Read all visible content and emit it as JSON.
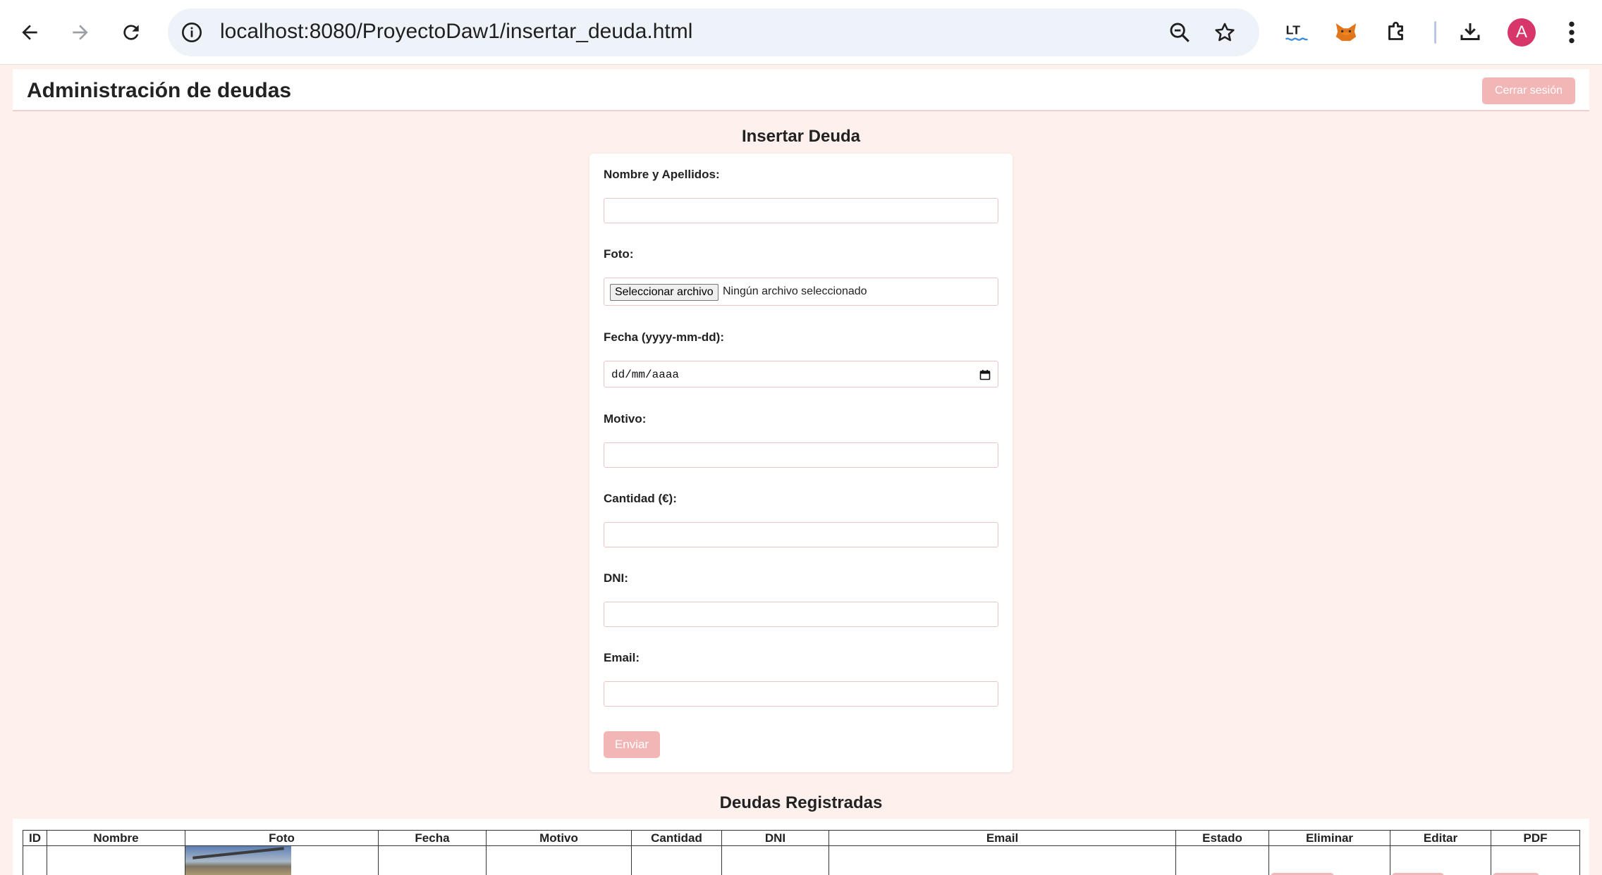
{
  "browser": {
    "url": "localhost:8080/ProyectoDaw1/insertar_deuda.html",
    "avatar_letter": "A"
  },
  "header": {
    "title": "Administración de deudas",
    "logout_label": "Cerrar sesión"
  },
  "form": {
    "heading": "Insertar Deuda",
    "name_label": "Nombre y Apellidos:",
    "photo_label": "Foto:",
    "file_button_label": "Seleccionar archivo",
    "file_status": "Ningún archivo seleccionado",
    "date_label": "Fecha (yyyy-mm-dd):",
    "date_placeholder": "dd/mm/aaaa",
    "reason_label": "Motivo:",
    "amount_label": "Cantidad (€):",
    "dni_label": "DNI:",
    "email_label": "Email:",
    "submit_label": "Enviar"
  },
  "table": {
    "heading": "Deudas Registradas",
    "columns": [
      "ID",
      "Nombre",
      "Foto",
      "Fecha",
      "Motivo",
      "Cantidad",
      "DNI",
      "Email",
      "Estado",
      "Eliminar",
      "Editar",
      "PDF"
    ]
  },
  "colors": {
    "page_background": "#fdf0ed",
    "accent_button": "#f2b6b6",
    "input_border": "#ecc6c6"
  }
}
